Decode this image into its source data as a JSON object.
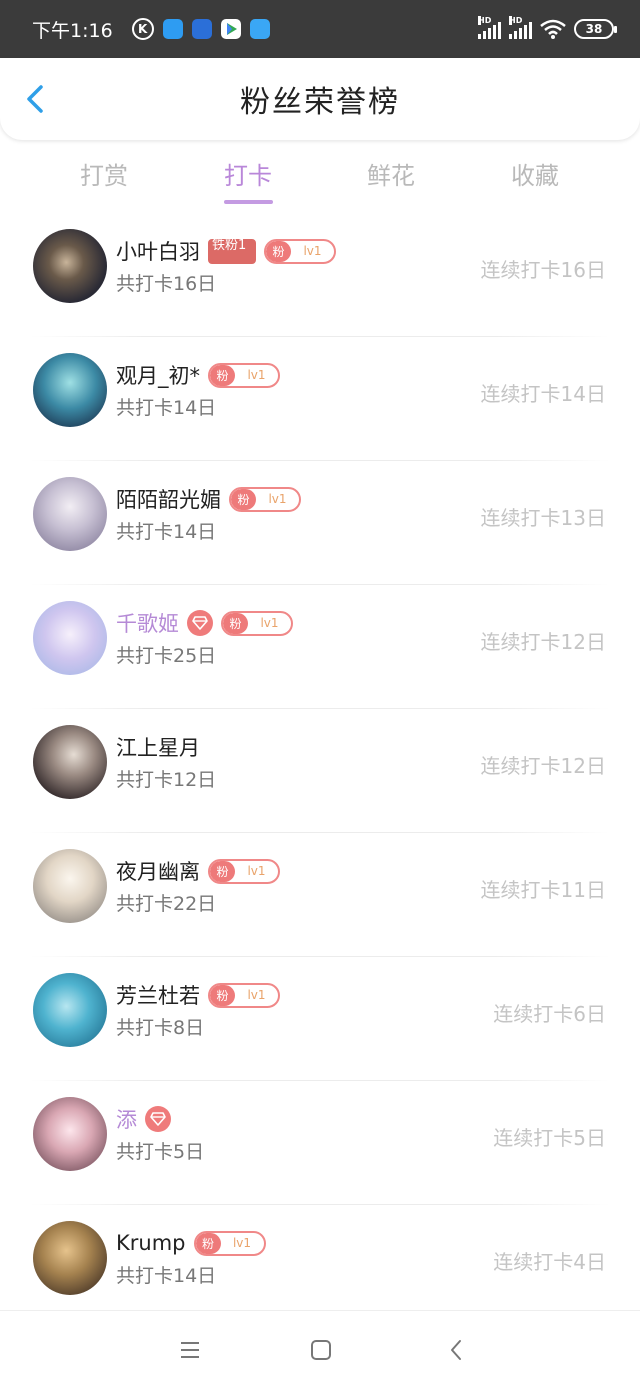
{
  "status_bar": {
    "time": "下午1:16",
    "k_icon": "K",
    "app_icons": [
      "app-blue-icon",
      "app-news-icon",
      "play-store-icon",
      "app-blue2-icon"
    ],
    "hd_label": "HD",
    "battery": "38"
  },
  "header": {
    "title": "粉丝荣誉榜"
  },
  "tabs": [
    {
      "label": "打赏",
      "active": false
    },
    {
      "label": "打卡",
      "active": true
    },
    {
      "label": "鲜花",
      "active": false
    },
    {
      "label": "收藏",
      "active": false
    }
  ],
  "badges": {
    "fan": "粉",
    "level": "lv1",
    "iron": "铁粉1"
  },
  "ranking": [
    {
      "name": "小叶白羽",
      "total": "共打卡16日",
      "streak": "连续打卡16日",
      "iron": true,
      "gem": false,
      "fan_badge": true,
      "name_color": "default"
    },
    {
      "name": "观月_初*",
      "total": "共打卡14日",
      "streak": "连续打卡14日",
      "iron": false,
      "gem": false,
      "fan_badge": true,
      "name_color": "default"
    },
    {
      "name": "陌陌韶光媚",
      "total": "共打卡14日",
      "streak": "连续打卡13日",
      "iron": false,
      "gem": false,
      "fan_badge": true,
      "name_color": "default"
    },
    {
      "name": "千歌姬",
      "total": "共打卡25日",
      "streak": "连续打卡12日",
      "iron": false,
      "gem": true,
      "fan_badge": true,
      "name_color": "purple"
    },
    {
      "name": "江上星月",
      "total": "共打卡12日",
      "streak": "连续打卡12日",
      "iron": false,
      "gem": false,
      "fan_badge": false,
      "name_color": "default"
    },
    {
      "name": "夜月幽离",
      "total": "共打卡22日",
      "streak": "连续打卡11日",
      "iron": false,
      "gem": false,
      "fan_badge": true,
      "name_color": "default"
    },
    {
      "name": "芳兰杜若",
      "total": "共打卡8日",
      "streak": "连续打卡6日",
      "iron": false,
      "gem": false,
      "fan_badge": true,
      "name_color": "default"
    },
    {
      "name": "添",
      "total": "共打卡5日",
      "streak": "连续打卡5日",
      "iron": false,
      "gem": true,
      "fan_badge": false,
      "name_color": "purple"
    },
    {
      "name": "Krump",
      "total": "共打卡14日",
      "streak": "连续打卡4日",
      "iron": false,
      "gem": false,
      "fan_badge": true,
      "name_color": "default"
    }
  ],
  "colors": {
    "accent": "#b987d9",
    "fan_badge": "#ee7a7a",
    "iron_badge": "#dc6a66",
    "streak_text": "#c4c4c4",
    "status_bar": "#3b3b3b",
    "back_arrow": "#2f9fe8"
  },
  "nav": {
    "icons": [
      "menu-icon",
      "home-square-icon",
      "back-icon"
    ]
  }
}
